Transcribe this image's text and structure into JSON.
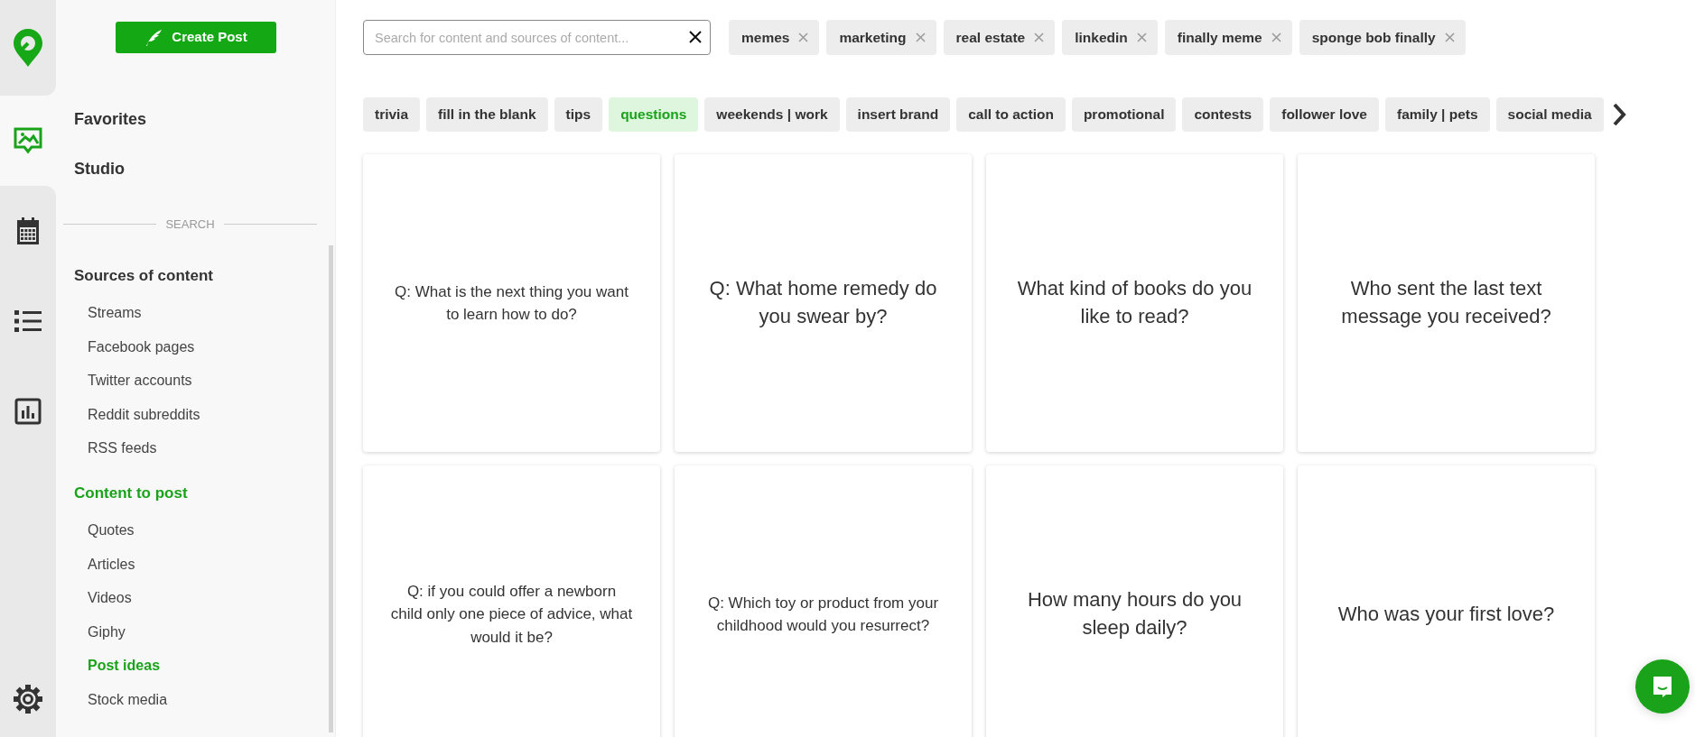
{
  "rail_items": [
    {
      "kind": "image",
      "selected": true
    },
    {
      "kind": "calendar",
      "selected": false
    },
    {
      "kind": "list",
      "selected": false
    },
    {
      "kind": "chart",
      "selected": false
    },
    {
      "kind": "settings",
      "selected": false
    }
  ],
  "sidebar": {
    "create_button": "Create Post",
    "top_links": [
      "Favorites",
      "Studio"
    ],
    "divider_label": "SEARCH",
    "sections": [
      {
        "title": "Sources of content",
        "active": false,
        "items": [
          {
            "label": "Streams",
            "selected": false
          },
          {
            "label": "Facebook pages",
            "selected": false
          },
          {
            "label": "Twitter accounts",
            "selected": false
          },
          {
            "label": "Reddit subreddits",
            "selected": false
          },
          {
            "label": "RSS feeds",
            "selected": false
          }
        ]
      },
      {
        "title": "Content to post",
        "active": true,
        "items": [
          {
            "label": "Quotes",
            "selected": false
          },
          {
            "label": "Articles",
            "selected": false
          },
          {
            "label": "Videos",
            "selected": false
          },
          {
            "label": "Giphy",
            "selected": false
          },
          {
            "label": "Post ideas",
            "selected": true
          },
          {
            "label": "Stock media",
            "selected": false
          }
        ]
      }
    ]
  },
  "search": {
    "placeholder": "Search for content and sources of content..."
  },
  "tags": [
    "memes",
    "marketing",
    "real estate",
    "linkedin",
    "finally meme",
    "sponge bob finally"
  ],
  "categories": [
    {
      "label": "trivia",
      "selected": false
    },
    {
      "label": "fill in the blank",
      "selected": false
    },
    {
      "label": "tips",
      "selected": false
    },
    {
      "label": "questions",
      "selected": true
    },
    {
      "label": "weekends | work",
      "selected": false
    },
    {
      "label": "insert brand",
      "selected": false
    },
    {
      "label": "call to action",
      "selected": false
    },
    {
      "label": "promotional",
      "selected": false
    },
    {
      "label": "contests",
      "selected": false
    },
    {
      "label": "follower love",
      "selected": false
    },
    {
      "label": "family | pets",
      "selected": false
    },
    {
      "label": "social media",
      "selected": false
    }
  ],
  "cards": [
    {
      "text": "Q: What is the next thing you want to learn how to do?",
      "kind": "small"
    },
    {
      "text": "Q: What home remedy do you swear by?",
      "kind": "large"
    },
    {
      "text": "What kind of books do you like to read?",
      "kind": "large"
    },
    {
      "text": "Who sent the last text message you received?",
      "kind": "large"
    },
    {
      "text": "Q: if you could offer a newborn child only one piece of advice, what would it be?",
      "kind": "small"
    },
    {
      "text": "Q: Which toy or product from your childhood would you resurrect?",
      "kind": "small"
    },
    {
      "text": "How many hours do you sleep daily?",
      "kind": "large"
    },
    {
      "text": "Who was your first love?",
      "kind": "large"
    }
  ]
}
